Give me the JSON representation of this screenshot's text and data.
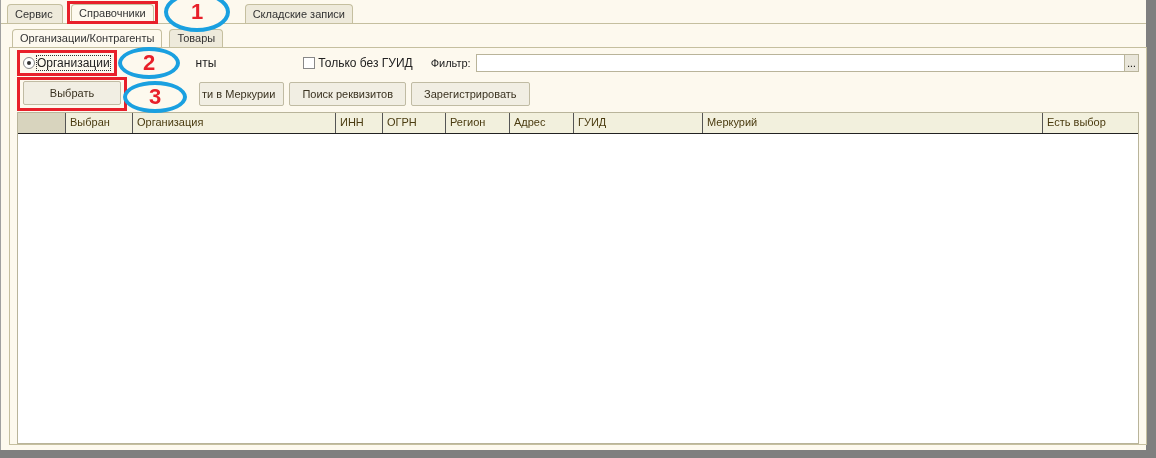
{
  "top_tabs": [
    {
      "label": "Сервис",
      "selected": false,
      "highlighted": false
    },
    {
      "label": "Справочники",
      "selected": true,
      "highlighted": true
    },
    {
      "label": "Складские записи",
      "selected": false,
      "highlighted": false
    }
  ],
  "sub_tabs": [
    {
      "label": "Организации/Контрагенты",
      "selected": true
    },
    {
      "label": "Товары",
      "selected": false
    }
  ],
  "radio": {
    "label": "Организации",
    "selected": true,
    "highlighted": true
  },
  "covered_radio_label": "нты",
  "checkbox": {
    "label": "Только без ГУИД",
    "checked": false
  },
  "filter": {
    "label": "Фильтр:",
    "button": "..."
  },
  "buttons": [
    {
      "label": "Выбрать",
      "highlighted": true
    },
    {
      "label": "ти в Меркурии",
      "highlighted": false
    },
    {
      "label": "Поиск реквизитов",
      "highlighted": false
    },
    {
      "label": "Зарегистрировать",
      "highlighted": false
    }
  ],
  "table": {
    "columns": [
      "Выбран",
      "Организация",
      "ИНН",
      "ОГРН",
      "Регион",
      "Адрес",
      "ГУИД",
      "Меркурий",
      "Есть выбор"
    ]
  },
  "callouts": [
    {
      "number": "1"
    },
    {
      "number": "2"
    },
    {
      "number": "3"
    }
  ]
}
